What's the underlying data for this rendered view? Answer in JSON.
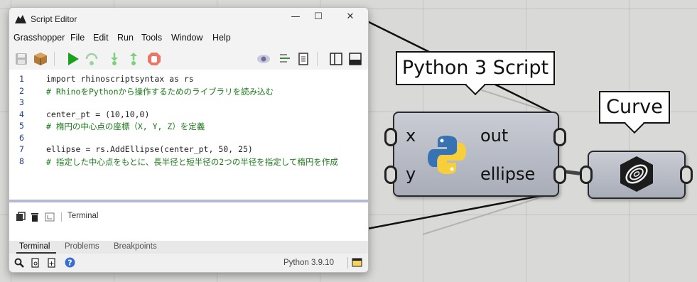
{
  "window": {
    "title": "Script Editor",
    "minimize": "—",
    "maximize": "☐",
    "close": "✕"
  },
  "menu": [
    "Grasshopper",
    "File",
    "Edit",
    "Run",
    "Tools",
    "Window",
    "Help"
  ],
  "code_lines": [
    {
      "num": "1",
      "text": "import rhinoscriptsyntax as rs",
      "comment": false
    },
    {
      "num": "2",
      "text": "# RhinoをPythonから操作するためのライブラリを読み込む",
      "comment": true
    },
    {
      "num": "3",
      "text": "",
      "comment": false
    },
    {
      "num": "4",
      "text": "center_pt = (10,10,0)",
      "comment": false
    },
    {
      "num": "5",
      "text": "# 楕円の中心点の座標（X, Y, Z）を定義",
      "comment": true
    },
    {
      "num": "6",
      "text": "",
      "comment": false
    },
    {
      "num": "7",
      "text": "ellipse = rs.AddEllipse(center_pt, 50, 25)",
      "comment": false
    },
    {
      "num": "8",
      "text": "# 指定した中心点をもとに、長半径と短半径の2つの半径を指定して楕円を作成",
      "comment": true
    }
  ],
  "terminal": {
    "label": "Terminal"
  },
  "bottom_tabs": [
    "Terminal",
    "Problems",
    "Breakpoints"
  ],
  "status": {
    "version": "Python 3.9.10"
  },
  "python_component": {
    "tooltip": "Python 3 Script",
    "inputs": [
      "x",
      "y"
    ],
    "outputs": [
      "out",
      "ellipse"
    ]
  },
  "curve_component": {
    "tooltip": "Curve"
  },
  "colors": {
    "comment": "#1a7a1a",
    "line_number": "#1f3f8f",
    "run": "#1aa31a",
    "stop": "#e04a3a"
  }
}
